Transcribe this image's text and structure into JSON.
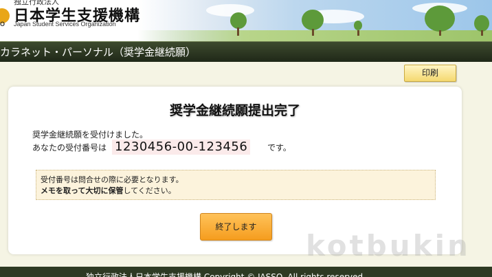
{
  "header": {
    "org_top": "独立行政法人",
    "org_name": "日本学生支援機構",
    "org_en": "Japan Student Services Organization",
    "logo_mark": "O"
  },
  "titlebar": {
    "title": "カラネット・パーソナル（奨学金継続願）"
  },
  "toolbar": {
    "print_label": "印刷"
  },
  "main": {
    "title": "奨学金継続願提出完了",
    "line1": "奨学金継続願を受付けました。",
    "line2_prefix": "あなたの受付番号は",
    "receipt_number": "1230456-00-123456",
    "line2_suffix": "です。",
    "notice_line1": "受付番号は問合せの際に必要となります。",
    "notice_line2_a": "メモを取って大切に保管",
    "notice_line2_b": "してください。",
    "finish_label": "終了します"
  },
  "watermark": "kotbukin",
  "footer": {
    "copyright": "独立行政法人日本学生支援機構 Copyright © JASSO. All rights reserved."
  },
  "colors": {
    "title_bar": "#2b3520",
    "print_button": "#f5d970",
    "finish_button": "#f59d1e",
    "notice_bg": "#fcf3dc",
    "receipt_bg": "#fbeaea"
  }
}
